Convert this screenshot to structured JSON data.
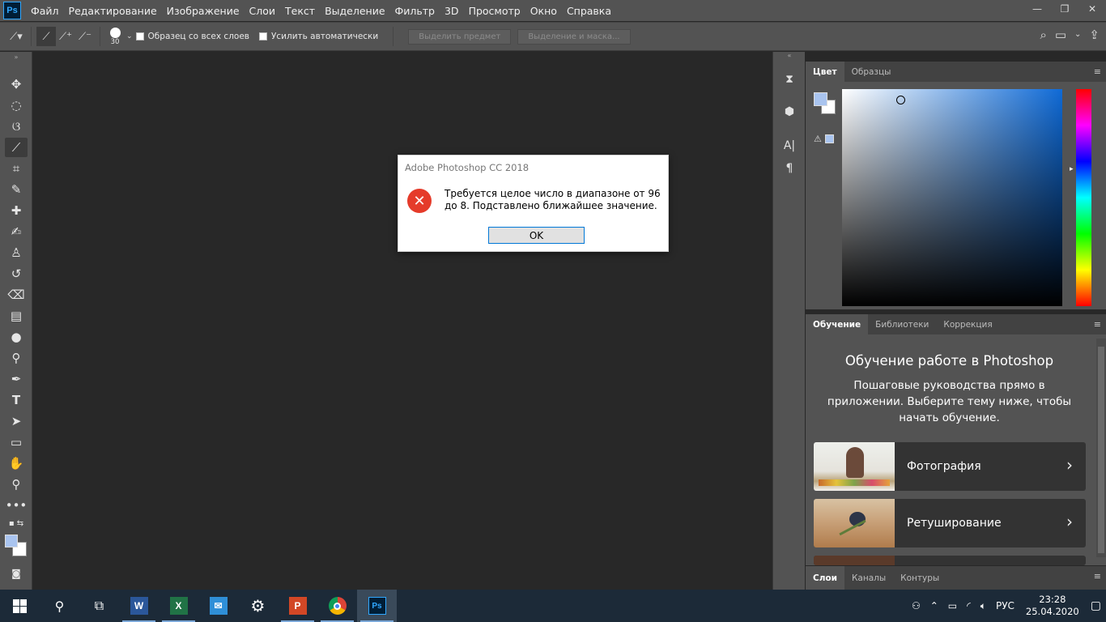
{
  "app": {
    "logo": "Ps"
  },
  "menu": [
    "Файл",
    "Редактирование",
    "Изображение",
    "Слои",
    "Текст",
    "Выделение",
    "Фильтр",
    "3D",
    "Просмотр",
    "Окно",
    "Справка"
  ],
  "window_controls": {
    "minimize": "—",
    "restore": "❐",
    "close": "✕"
  },
  "options_bar": {
    "brush_size": "30",
    "sample_all_layers": "Образец со всех слоев",
    "auto_enhance": "Усилить автоматически",
    "select_subject": "Выделить предмет",
    "select_and_mask": "Выделение и маска..."
  },
  "color_panel": {
    "tabs": [
      "Цвет",
      "Образцы"
    ],
    "foreground_color": "#a9c4ef",
    "background_color": "#ffffff"
  },
  "learn_panel": {
    "tabs": [
      "Обучение",
      "Библиотеки",
      "Коррекция"
    ],
    "title": "Обучение работе в Photoshop",
    "description": "Пошаговые руководства прямо в приложении. Выберите тему ниже, чтобы начать обучение.",
    "cards": [
      "Фотография",
      "Ретуширование"
    ]
  },
  "layers_panel": {
    "tabs": [
      "Слои",
      "Каналы",
      "Контуры"
    ]
  },
  "dialog": {
    "title": "Adobe Photoshop CC 2018",
    "message": "Требуется целое число в диапазоне от 96 до 8.  Подставлено ближайшее значение.",
    "ok": "OK"
  },
  "taskbar": {
    "language": "РУС",
    "time": "23:28",
    "date": "25.04.2020",
    "apps": [
      "Word",
      "Excel",
      "Outlook",
      "Settings",
      "PowerPoint",
      "Chrome",
      "Photoshop"
    ]
  },
  "colors": {
    "ui_gray": "#535353",
    "canvas": "#282828",
    "dialog_error": "#e53b2a",
    "accent": "#0078d7"
  }
}
